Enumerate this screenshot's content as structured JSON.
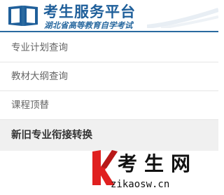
{
  "header": {
    "logo_icon": "open-book-icon",
    "title": "考生服务平台",
    "subtitle": "湖北省高等教育自学考试"
  },
  "menu": {
    "items": [
      {
        "label": "专业计划查询",
        "active": false
      },
      {
        "label": "教材大纲查询",
        "active": false
      },
      {
        "label": "课程顶替",
        "active": false
      },
      {
        "label": "新旧专业衔接转换",
        "active": true
      }
    ]
  },
  "watermark": {
    "logo_icon": "k-logo-icon",
    "title": "考生网",
    "url": "zikaosw.cn"
  },
  "colors": {
    "brand_blue": "#1f5f9a",
    "active_bg": "#f0f0f0",
    "watermark_red": "#e02020"
  }
}
